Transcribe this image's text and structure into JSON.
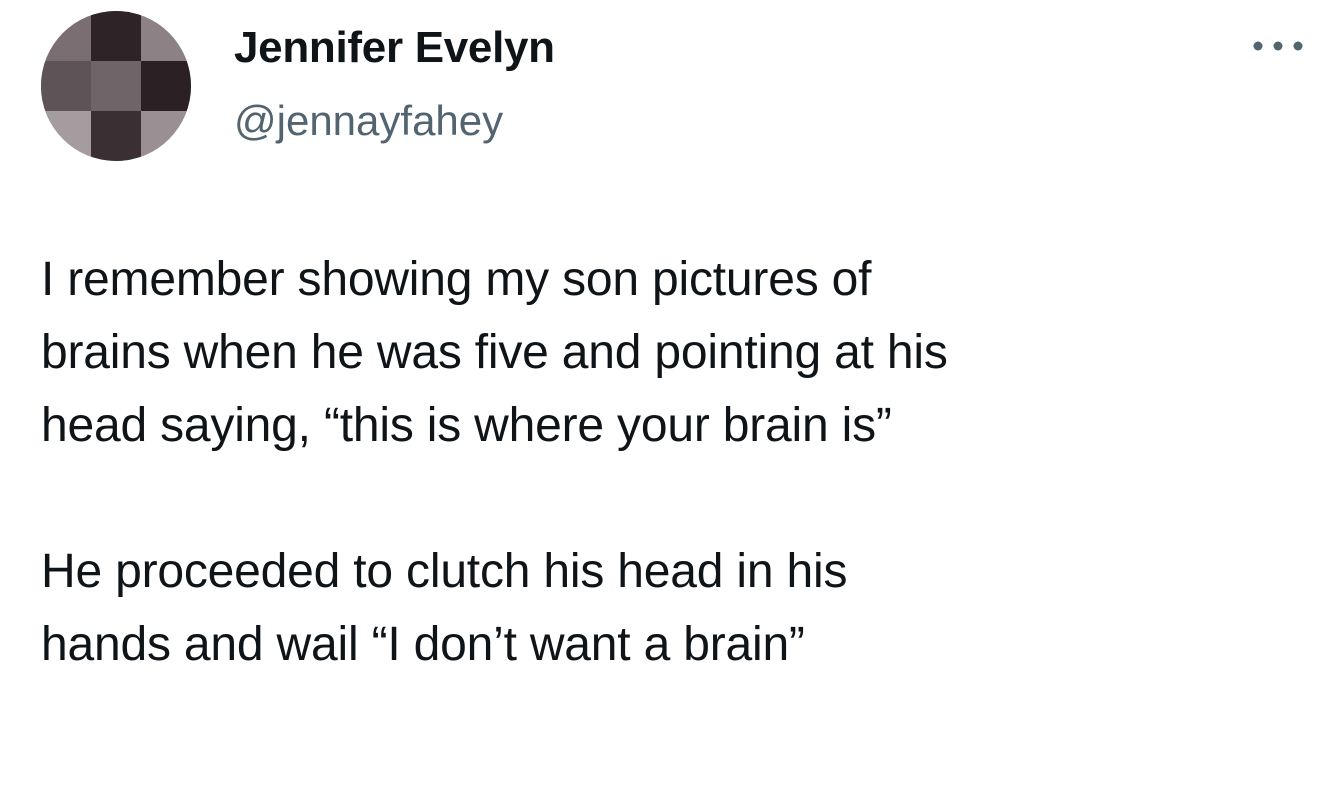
{
  "author": {
    "name": "Jennifer Evelyn",
    "handle": "@jennayfahey",
    "avatar_colors": [
      "#3b3236",
      "#8a7f83",
      "#2a2226",
      "#a8a0a3",
      "#5e5458",
      "#3a3034",
      "#7c7074",
      "#4a4044",
      "#9a9094"
    ]
  },
  "menu": {
    "icon": "more-horizontal-icon"
  },
  "tweet": {
    "lines": [
      "I remember showing my son pictures of",
      "brains when he was five and pointing at his",
      "head saying, “this is where your brain is”",
      "",
      "He proceeded to clutch his head in his",
      "hands and wail “I don’t want a brain”"
    ]
  },
  "colors": {
    "text": "#0f1419",
    "secondary_text": "#536471",
    "background": "#ffffff"
  }
}
